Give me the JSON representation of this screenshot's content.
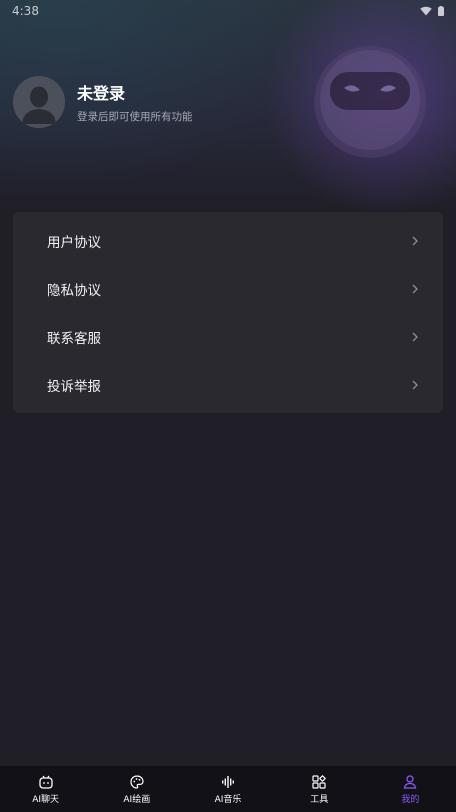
{
  "status_bar": {
    "time": "4:38"
  },
  "user": {
    "name": "未登录",
    "subtitle": "登录后即可使用所有功能"
  },
  "menu": {
    "items": [
      {
        "label": "用户协议"
      },
      {
        "label": "隐私协议"
      },
      {
        "label": "联系客服"
      },
      {
        "label": "投诉举报"
      }
    ]
  },
  "tabbar": {
    "tabs": [
      {
        "label": "AI聊天",
        "icon": "chat-bot-icon"
      },
      {
        "label": "AI绘画",
        "icon": "palette-icon"
      },
      {
        "label": "AI音乐",
        "icon": "audio-wave-icon"
      },
      {
        "label": "工具",
        "icon": "grid-tools-icon"
      },
      {
        "label": "我的",
        "icon": "person-icon"
      }
    ],
    "active_index": 4
  },
  "colors": {
    "accent": "#8b5cf6",
    "background": "#201f28",
    "card": "#2a2930",
    "tabbar": "#121117"
  }
}
